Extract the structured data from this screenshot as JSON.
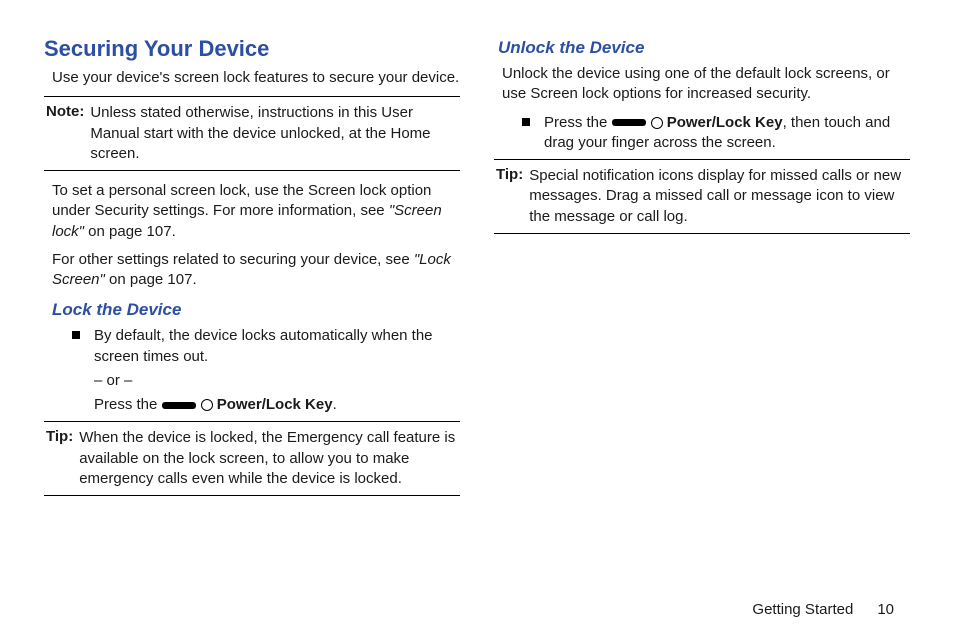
{
  "left": {
    "heading": "Securing Your Device",
    "intro": "Use your device's screen lock features to secure your device.",
    "note1_label": "Note:",
    "note1_text": "Unless stated otherwise, instructions in this User Manual start with the device unlocked, at the Home screen.",
    "para1_a": "To set a personal screen lock, use the Screen lock option under Security settings. For more information, see ",
    "para1_ref": "\"Screen lock\"",
    "para1_b": " on page 107.",
    "para2_a": "For other settings related to securing your device, see ",
    "para2_ref": "\"Lock Screen\"",
    "para2_b": " on page 107.",
    "lock_heading": "Lock the Device",
    "lock_li1": "By default, the device locks automatically when the screen times out.",
    "or": "– or –",
    "press_the": "Press the ",
    "power_key_label": " Power/Lock Key",
    "period": ".",
    "tip1_label": "Tip:",
    "tip1_text": "When the device is locked, the Emergency call feature is available on the lock screen, to allow you to make emergency calls even while the device is locked."
  },
  "right": {
    "unlock_heading": "Unlock the Device",
    "unlock_intro": "Unlock the device using one of the default lock screens, or use Screen lock options for increased security.",
    "press_the": "Press the ",
    "power_key_label": " Power/Lock Key",
    "unlock_li_tail": ", then touch and drag your finger across the screen.",
    "tip2_label": "Tip:",
    "tip2_text": "Special notification icons display for missed calls or new messages. Drag a missed call or message icon to view the message or call log."
  },
  "footer": {
    "section": "Getting Started",
    "page": "10"
  }
}
